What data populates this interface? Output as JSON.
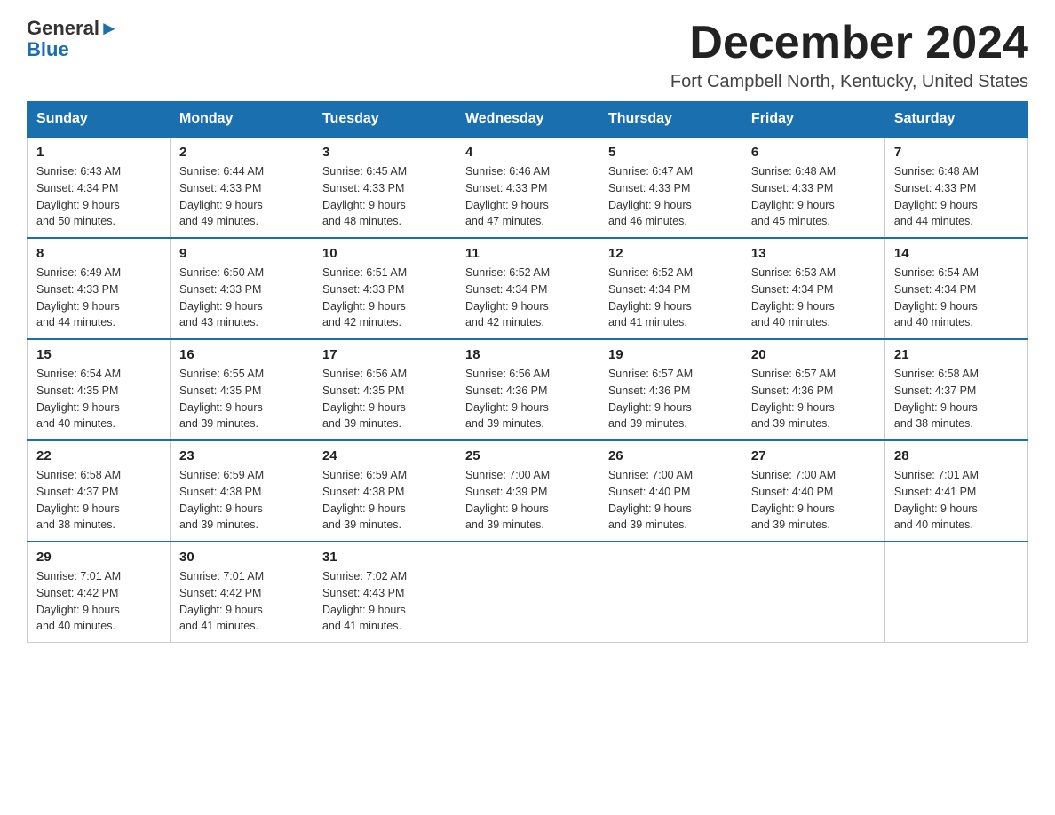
{
  "header": {
    "logo_text1": "General",
    "logo_text2": "Blue",
    "month_title": "December 2024",
    "location": "Fort Campbell North, Kentucky, United States"
  },
  "weekdays": [
    "Sunday",
    "Monday",
    "Tuesday",
    "Wednesday",
    "Thursday",
    "Friday",
    "Saturday"
  ],
  "weeks": [
    [
      {
        "day": "1",
        "sunrise": "6:43 AM",
        "sunset": "4:34 PM",
        "daylight": "9 hours and 50 minutes."
      },
      {
        "day": "2",
        "sunrise": "6:44 AM",
        "sunset": "4:33 PM",
        "daylight": "9 hours and 49 minutes."
      },
      {
        "day": "3",
        "sunrise": "6:45 AM",
        "sunset": "4:33 PM",
        "daylight": "9 hours and 48 minutes."
      },
      {
        "day": "4",
        "sunrise": "6:46 AM",
        "sunset": "4:33 PM",
        "daylight": "9 hours and 47 minutes."
      },
      {
        "day": "5",
        "sunrise": "6:47 AM",
        "sunset": "4:33 PM",
        "daylight": "9 hours and 46 minutes."
      },
      {
        "day": "6",
        "sunrise": "6:48 AM",
        "sunset": "4:33 PM",
        "daylight": "9 hours and 45 minutes."
      },
      {
        "day": "7",
        "sunrise": "6:48 AM",
        "sunset": "4:33 PM",
        "daylight": "9 hours and 44 minutes."
      }
    ],
    [
      {
        "day": "8",
        "sunrise": "6:49 AM",
        "sunset": "4:33 PM",
        "daylight": "9 hours and 44 minutes."
      },
      {
        "day": "9",
        "sunrise": "6:50 AM",
        "sunset": "4:33 PM",
        "daylight": "9 hours and 43 minutes."
      },
      {
        "day": "10",
        "sunrise": "6:51 AM",
        "sunset": "4:33 PM",
        "daylight": "9 hours and 42 minutes."
      },
      {
        "day": "11",
        "sunrise": "6:52 AM",
        "sunset": "4:34 PM",
        "daylight": "9 hours and 42 minutes."
      },
      {
        "day": "12",
        "sunrise": "6:52 AM",
        "sunset": "4:34 PM",
        "daylight": "9 hours and 41 minutes."
      },
      {
        "day": "13",
        "sunrise": "6:53 AM",
        "sunset": "4:34 PM",
        "daylight": "9 hours and 40 minutes."
      },
      {
        "day": "14",
        "sunrise": "6:54 AM",
        "sunset": "4:34 PM",
        "daylight": "9 hours and 40 minutes."
      }
    ],
    [
      {
        "day": "15",
        "sunrise": "6:54 AM",
        "sunset": "4:35 PM",
        "daylight": "9 hours and 40 minutes."
      },
      {
        "day": "16",
        "sunrise": "6:55 AM",
        "sunset": "4:35 PM",
        "daylight": "9 hours and 39 minutes."
      },
      {
        "day": "17",
        "sunrise": "6:56 AM",
        "sunset": "4:35 PM",
        "daylight": "9 hours and 39 minutes."
      },
      {
        "day": "18",
        "sunrise": "6:56 AM",
        "sunset": "4:36 PM",
        "daylight": "9 hours and 39 minutes."
      },
      {
        "day": "19",
        "sunrise": "6:57 AM",
        "sunset": "4:36 PM",
        "daylight": "9 hours and 39 minutes."
      },
      {
        "day": "20",
        "sunrise": "6:57 AM",
        "sunset": "4:36 PM",
        "daylight": "9 hours and 39 minutes."
      },
      {
        "day": "21",
        "sunrise": "6:58 AM",
        "sunset": "4:37 PM",
        "daylight": "9 hours and 38 minutes."
      }
    ],
    [
      {
        "day": "22",
        "sunrise": "6:58 AM",
        "sunset": "4:37 PM",
        "daylight": "9 hours and 38 minutes."
      },
      {
        "day": "23",
        "sunrise": "6:59 AM",
        "sunset": "4:38 PM",
        "daylight": "9 hours and 39 minutes."
      },
      {
        "day": "24",
        "sunrise": "6:59 AM",
        "sunset": "4:38 PM",
        "daylight": "9 hours and 39 minutes."
      },
      {
        "day": "25",
        "sunrise": "7:00 AM",
        "sunset": "4:39 PM",
        "daylight": "9 hours and 39 minutes."
      },
      {
        "day": "26",
        "sunrise": "7:00 AM",
        "sunset": "4:40 PM",
        "daylight": "9 hours and 39 minutes."
      },
      {
        "day": "27",
        "sunrise": "7:00 AM",
        "sunset": "4:40 PM",
        "daylight": "9 hours and 39 minutes."
      },
      {
        "day": "28",
        "sunrise": "7:01 AM",
        "sunset": "4:41 PM",
        "daylight": "9 hours and 40 minutes."
      }
    ],
    [
      {
        "day": "29",
        "sunrise": "7:01 AM",
        "sunset": "4:42 PM",
        "daylight": "9 hours and 40 minutes."
      },
      {
        "day": "30",
        "sunrise": "7:01 AM",
        "sunset": "4:42 PM",
        "daylight": "9 hours and 41 minutes."
      },
      {
        "day": "31",
        "sunrise": "7:02 AM",
        "sunset": "4:43 PM",
        "daylight": "9 hours and 41 minutes."
      },
      null,
      null,
      null,
      null
    ]
  ],
  "labels": {
    "sunrise": "Sunrise:",
    "sunset": "Sunset:",
    "daylight": "Daylight:"
  }
}
